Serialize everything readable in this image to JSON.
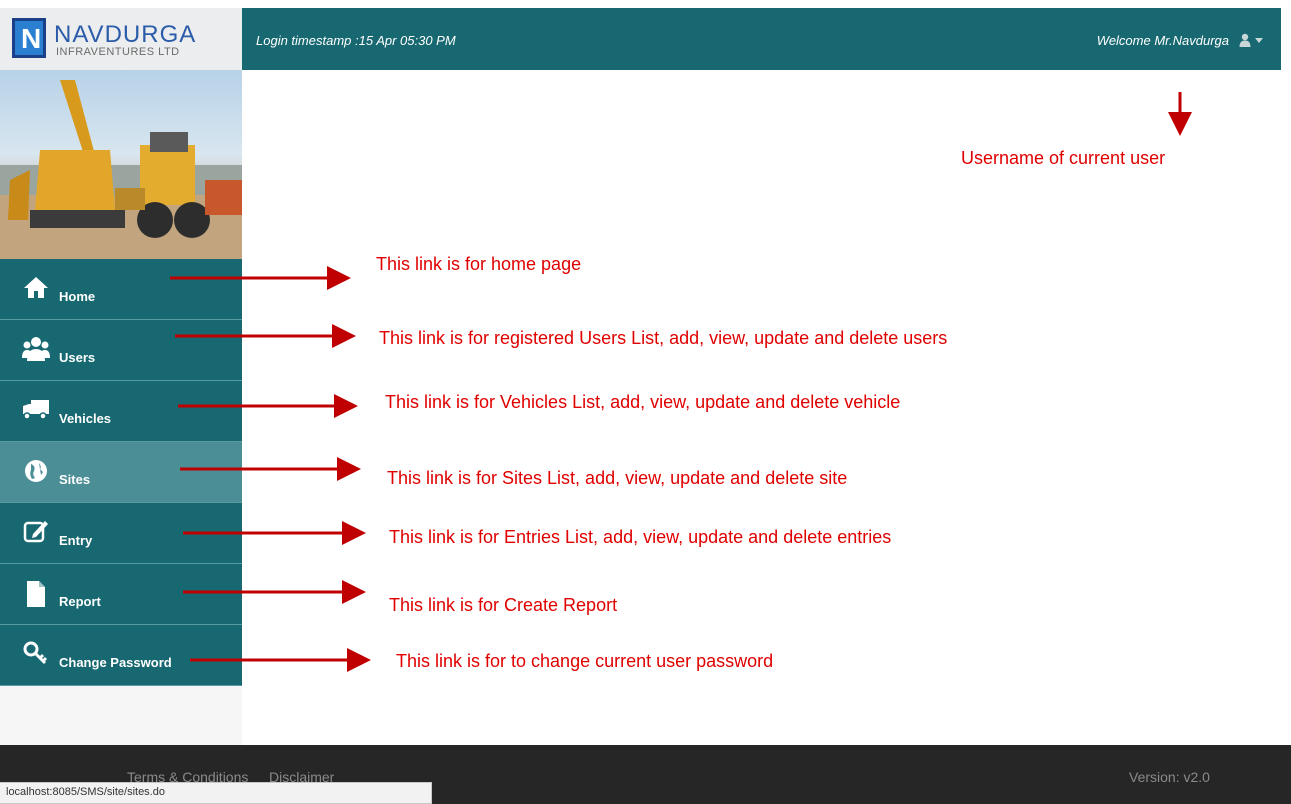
{
  "header": {
    "logo_title": "NAVDURGA",
    "logo_subtitle": "INFRAVENTURES LTD",
    "logo_letter": "N",
    "login_timestamp": "Login timestamp :15 Apr 05:30 PM",
    "welcome": "Welcome Mr.Navdurga",
    "user_icon": "user-icon",
    "dropdown_icon": "caret-down-icon"
  },
  "sidebar": {
    "items": [
      {
        "label": "Home",
        "icon": "home-icon",
        "glyph": "⌂",
        "active": false
      },
      {
        "label": "Users",
        "icon": "users-icon",
        "glyph": "☺",
        "active": false
      },
      {
        "label": "Vehicles",
        "icon": "truck-icon",
        "glyph": "⛟",
        "active": false
      },
      {
        "label": "Sites",
        "icon": "globe-icon",
        "glyph": "●",
        "active": true
      },
      {
        "label": "Entry",
        "icon": "edit-icon",
        "glyph": "✎",
        "active": false
      },
      {
        "label": "Report",
        "icon": "file-icon",
        "glyph": "▮",
        "active": false
      },
      {
        "label": "Change Password",
        "icon": "key-icon",
        "glyph": "⚿",
        "active": false
      }
    ]
  },
  "annotations": {
    "username": "Username of current user",
    "home": "This link is for home page",
    "users": "This link is for registered Users List, add, view, update and delete users",
    "vehicles": "This link is for Vehicles List, add, view, update and delete vehicle",
    "sites": "This link is for Sites List, add, view, update and delete site",
    "entry": "This link is for Entries List, add, view, update and delete entries",
    "report": "This link is for Create Report",
    "password": "This link is for to change current user password"
  },
  "footer": {
    "terms": "Terms & Conditions",
    "disclaimer": "Disclaimer",
    "version": "Version: v2.0"
  },
  "status_url": "localhost:8085/SMS/site/sites.do",
  "colors": {
    "header": "#176871",
    "nav": "#176871",
    "nav_active": "#4b8e96",
    "annotation": "#e00000",
    "arrow": "#c00000",
    "footer": "#262626"
  }
}
